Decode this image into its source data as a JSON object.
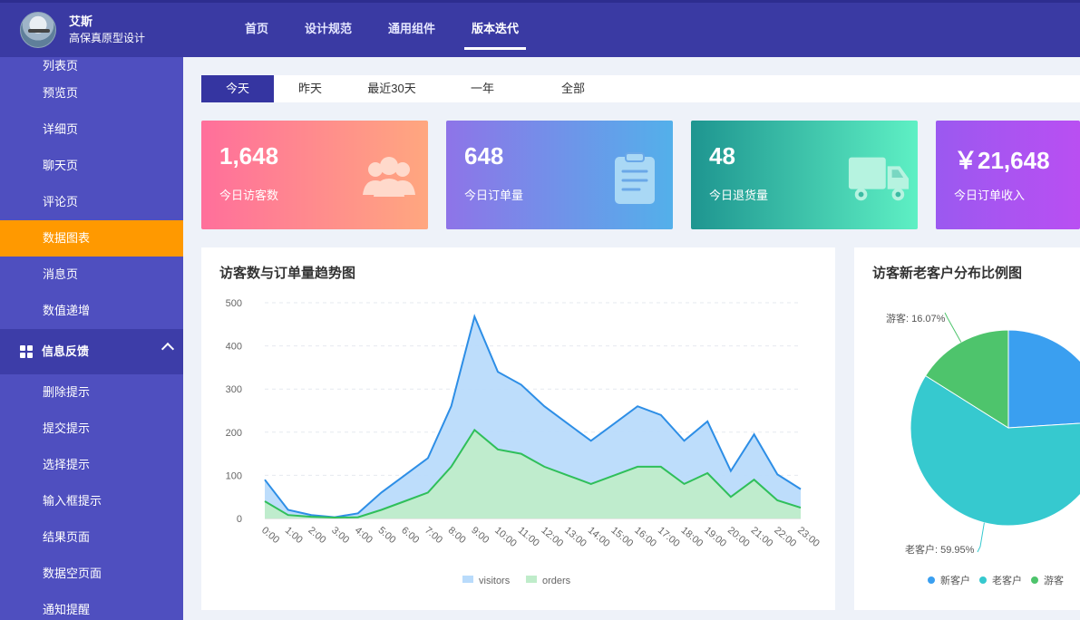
{
  "header": {
    "brand_name": "艾斯",
    "brand_sub": "高保真原型设计",
    "nav": [
      {
        "label": "首页",
        "active": false
      },
      {
        "label": "设计规范",
        "active": false
      },
      {
        "label": "通用组件",
        "active": false
      },
      {
        "label": "版本迭代",
        "active": true
      }
    ]
  },
  "sidebar": {
    "items_top": [
      "列表页",
      "预览页",
      "详细页",
      "聊天页",
      "评论页",
      "数据图表",
      "消息页",
      "数值递增"
    ],
    "active_item": "数据图表",
    "group": {
      "label": "信息反馈",
      "icon": "grid-icon"
    },
    "items_bottom": [
      "删除提示",
      "提交提示",
      "选择提示",
      "输入框提示",
      "结果页面",
      "数据空页面",
      "通知提醒"
    ]
  },
  "tabs": [
    "今天",
    "昨天",
    "最近30天",
    "一年",
    "全部"
  ],
  "active_tab": "今天",
  "cards": [
    {
      "value": "1,648",
      "label": "今日访客数",
      "icon": "users-icon"
    },
    {
      "value": "648",
      "label": "今日订单量",
      "icon": "clipboard-icon"
    },
    {
      "value": "48",
      "label": "今日退货量",
      "icon": "truck-icon"
    },
    {
      "value": "￥21,648",
      "label": "今日订单收入",
      "icon": "money-icon"
    }
  ],
  "trend_panel": {
    "title": "访客数与订单量趋势图"
  },
  "pie_panel": {
    "title": "访客新老客户分布比例图"
  },
  "chart_data": [
    {
      "type": "area",
      "title": "访客数与订单量趋势图",
      "x": [
        "0:00",
        "1:00",
        "2:00",
        "3:00",
        "4:00",
        "5:00",
        "6:00",
        "7:00",
        "8:00",
        "9:00",
        "10:00",
        "11:00",
        "12:00",
        "13:00",
        "14:00",
        "15:00",
        "16:00",
        "17:00",
        "18:00",
        "19:00",
        "20:00",
        "21:00",
        "22:00",
        "23:00"
      ],
      "yticks": [
        0,
        100,
        200,
        300,
        400,
        500
      ],
      "ylim": [
        0,
        500
      ],
      "series": [
        {
          "name": "visitors",
          "color": "#2d8ee6",
          "fill": "#b9dbfb",
          "values": [
            90,
            20,
            8,
            3,
            12,
            60,
            100,
            140,
            260,
            468,
            340,
            310,
            260,
            220,
            180,
            220,
            260,
            240,
            180,
            225,
            110,
            195,
            102,
            68
          ]
        },
        {
          "name": "orders",
          "color": "#2fbf5a",
          "fill": "#bfecca",
          "values": [
            40,
            8,
            4,
            2,
            3,
            20,
            40,
            60,
            120,
            205,
            160,
            150,
            120,
            100,
            80,
            100,
            120,
            120,
            80,
            105,
            50,
            90,
            42,
            25
          ]
        }
      ],
      "legend_position": "bottom"
    },
    {
      "type": "pie",
      "title": "访客新老客户分布比例图",
      "categories": [
        "新客户",
        "老客户",
        "游客"
      ],
      "values": [
        23.98,
        59.95,
        16.07
      ],
      "colors": [
        "#3a9ff0",
        "#36c9cf",
        "#4ec46c"
      ],
      "labels": [
        "",
        "老客户: 59.95%",
        "游客: 16.07%"
      ],
      "legend_position": "bottom"
    }
  ]
}
